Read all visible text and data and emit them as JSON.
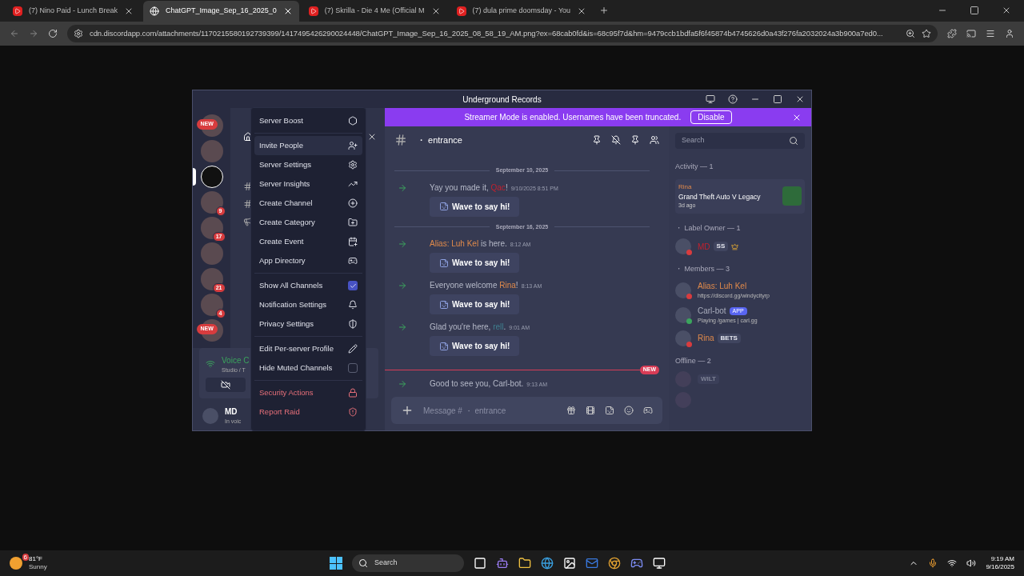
{
  "browser": {
    "tabs": [
      {
        "kind": "video",
        "label": "(7) Nino Paid - Lunch Break",
        "selected": false
      },
      {
        "kind": "image",
        "label": "ChatGPT_Image_Sep_16_2025_0",
        "selected": true
      },
      {
        "kind": "video",
        "label": "(7) Skrilla - Die 4 Me (Official M",
        "selected": false
      },
      {
        "kind": "video",
        "label": "(7) dula prime doomsday - You",
        "selected": false
      }
    ],
    "url": "cdn.discordapp.com/attachments/1170215580192739399/1417495426290024448/ChatGPT_Image_Sep_16_2025_08_58_19_AM.png?ex=68cab0fd&is=68c95f7d&hm=9479ccb1bdfa5f6f45874b4745626d0a43f276fa2032024a3b900a7ed0..."
  },
  "discord": {
    "title": "Underground Records",
    "banner": {
      "text": "Streamer Mode is enabled. Usernames have been truncated.",
      "button": "Disable"
    },
    "servers": [
      {
        "badge": "NEW",
        "kind": "new",
        "selected": false
      },
      {
        "kind": "plain",
        "selected": false
      },
      {
        "kind": "plain",
        "selected": true
      },
      {
        "badge": "9",
        "kind": "count",
        "selected": false
      },
      {
        "badge": "17",
        "kind": "count",
        "selected": false
      },
      {
        "kind": "plain",
        "selected": false
      },
      {
        "badge": "21",
        "kind": "count",
        "selected": false
      },
      {
        "badge": "4",
        "kind": "count",
        "selected": false
      },
      {
        "badge": "NEW",
        "kind": "new",
        "selected": false
      }
    ],
    "voice": {
      "status": "Voice C",
      "channel": "Studio / T"
    },
    "user": {
      "name": "MD",
      "status": "In voic"
    },
    "channel": "・ entrance",
    "days": [
      {
        "date": "September 10, 2025",
        "messages": [
          {
            "before": "Yay you made it, ",
            "name": "Qac",
            "color": "#c0212f",
            "after": "!",
            "time": "9/10/2025 8:51 PM",
            "wave": "Wave to say hi!",
            "new_divider": false
          }
        ]
      },
      {
        "date": "September 16, 2025",
        "messages": [
          {
            "name": "Alias: Luh Kel",
            "color": "#e08a4b",
            "after": " is here.",
            "time": "8:12 AM",
            "wave": "Wave to say hi!",
            "new_divider": false
          },
          {
            "before": "Everyone welcome ",
            "name": "Rina",
            "color": "#e08a4b",
            "after": "!",
            "time": "8:13 AM",
            "wave": "Wave to say hi!",
            "new_divider": false
          },
          {
            "before": "Glad you're here, ",
            "name": "rell",
            "color": "#3f7f8f",
            "after": ".",
            "time": "9:01 AM",
            "wave": "Wave to say hi!",
            "new_divider": false
          },
          {
            "before": "Good to see you, Carl-bot.",
            "time": "9:13 AM",
            "new_divider": true,
            "new_label": "NEW"
          }
        ]
      }
    ],
    "composer": {
      "placeholder": "Message # ・ entrance"
    },
    "members": {
      "search": {
        "placeholder": "Search"
      },
      "activity": {
        "heading": "Activity — 1",
        "name": "Rina",
        "game": "Grand Theft Auto V Legacy",
        "ago": "3d ago"
      },
      "groups": [
        {
          "heading": "・ Label Owner — 1",
          "members": [
            {
              "name": "MD",
              "color": "#c0212f",
              "status_dot": {
                "color": "#d83c3e"
              },
              "tag": "SS",
              "crown": true,
              "offline": false
            }
          ]
        },
        {
          "heading": "・ Members — 3",
          "members": [
            {
              "name": "Alias: Luh Kel",
              "color": "#e08a4b",
              "status_dot": {
                "color": "#d83c3e"
              },
              "subtitle": "https://discord.gg/windycityrp",
              "crown": false,
              "offline": false
            },
            {
              "name": "Carl-bot",
              "color": "#a9adbc",
              "status_dot": {
                "color": "#3ba55d"
              },
              "app": "APP",
              "subtitle": "Playing /games | carl.gg",
              "crown": false,
              "offline": false
            },
            {
              "name": "Rina",
              "color": "#e08a4b",
              "status_dot": {
                "color": "#d83c3e"
              },
              "tag": "BETS",
              "crown": false,
              "offline": false
            }
          ]
        },
        {
          "heading": "Offline — 2",
          "members": [
            {
              "tag": "WILT",
              "crown": false,
              "offline": true
            },
            {
              "crown": false,
              "offline": true
            }
          ]
        }
      ]
    }
  },
  "menu": {
    "groups": [
      [
        {
          "label": "Server Boost",
          "kind": "icon",
          "danger": false,
          "hovered": false
        }
      ],
      [
        {
          "label": "Invite People",
          "kind": "icon",
          "danger": false,
          "hovered": true
        },
        {
          "label": "Server Settings",
          "kind": "icon",
          "danger": false,
          "hovered": false
        },
        {
          "label": "Server Insights",
          "kind": "icon",
          "danger": false,
          "hovered": false
        },
        {
          "label": "Create Channel",
          "kind": "icon",
          "danger": false,
          "hovered": false
        },
        {
          "label": "Create Category",
          "kind": "icon",
          "danger": false,
          "hovered": false
        },
        {
          "label": "Create Event",
          "kind": "icon",
          "danger": false,
          "hovered": false
        },
        {
          "label": "App Directory",
          "kind": "icon",
          "danger": false,
          "hovered": false
        }
      ],
      [
        {
          "label": "Show All Channels",
          "kind": "checkbox",
          "checked": true,
          "danger": false,
          "hovered": false
        },
        {
          "label": "Notification Settings",
          "kind": "icon",
          "danger": false,
          "hovered": false
        },
        {
          "label": "Privacy Settings",
          "kind": "icon",
          "danger": false,
          "hovered": false
        }
      ],
      [
        {
          "label": "Edit Per-server Profile",
          "kind": "icon",
          "danger": false,
          "hovered": false
        },
        {
          "label": "Hide Muted Channels",
          "kind": "checkbox",
          "checked": false,
          "danger": false,
          "hovered": false
        }
      ],
      [
        {
          "label": "Security Actions",
          "kind": "icon",
          "danger": true,
          "hovered": false
        },
        {
          "label": "Report Raid",
          "kind": "icon",
          "danger": true,
          "hovered": false
        }
      ]
    ]
  },
  "taskbar": {
    "weather": {
      "temp": "81°F",
      "text": "Sunny",
      "badge": "6"
    },
    "search": {
      "placeholder": "Search"
    },
    "time": "9:19 AM",
    "date": "9/16/2025"
  }
}
